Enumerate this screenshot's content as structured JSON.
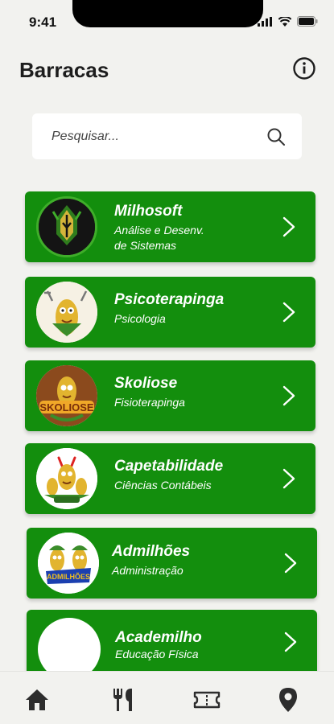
{
  "status": {
    "time": "9:41"
  },
  "header": {
    "title": "Barracas"
  },
  "search": {
    "placeholder": "Pesquisar..."
  },
  "cards": [
    {
      "title": "Milhosoft",
      "subtitle_line1": "Análise e Desenv.",
      "subtitle_line2": "de Sistemas"
    },
    {
      "title": "Psicoterapinga",
      "subtitle_line1": "Psicologia"
    },
    {
      "title": "Skoliose",
      "subtitle_line1": "Fisioterapinga"
    },
    {
      "title": "Capetabilidade",
      "subtitle_line1": "Ciências Contábeis"
    },
    {
      "title": "Admilhões",
      "subtitle_line1": "Administração"
    },
    {
      "title": "Academilho",
      "subtitle_line1": "Educação Física"
    }
  ],
  "nav": [
    "home-icon",
    "restaurant-icon",
    "ticket-icon",
    "location-pin-icon"
  ],
  "colors": {
    "card": "#138e0d",
    "background": "#f2f2ef",
    "text": "#1d1d1d"
  }
}
